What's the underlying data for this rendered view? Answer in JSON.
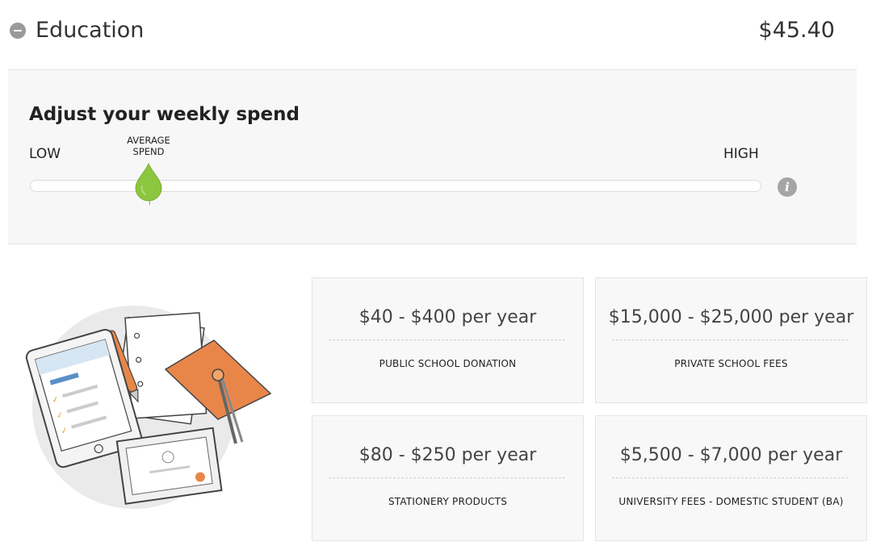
{
  "header": {
    "title": "Education",
    "amount": "$45.40"
  },
  "spend_panel": {
    "title": "Adjust your weekly spend",
    "low_label": "LOW",
    "high_label": "HIGH",
    "marker_label_line1": "AVERAGE",
    "marker_label_line2": "SPEND",
    "slider_level": 0.165,
    "accent_color": "#8cc63f"
  },
  "cards": [
    {
      "range": "$40 - $400 per year",
      "label": "PUBLIC SCHOOL DONATION"
    },
    {
      "range": "$15,000 - $25,000 per year",
      "label": "PRIVATE SCHOOL FEES"
    },
    {
      "range": "$80 - $250 per year",
      "label": "STATIONERY PRODUCTS"
    },
    {
      "range": "$5,500 - $7,000 per year",
      "label": "UNIVERSITY FEES - DOMESTIC STUDENT (BA)"
    }
  ],
  "icons": {
    "collapse": "minus-circle-icon",
    "info": "info-icon",
    "illustration": "education-illustration"
  }
}
